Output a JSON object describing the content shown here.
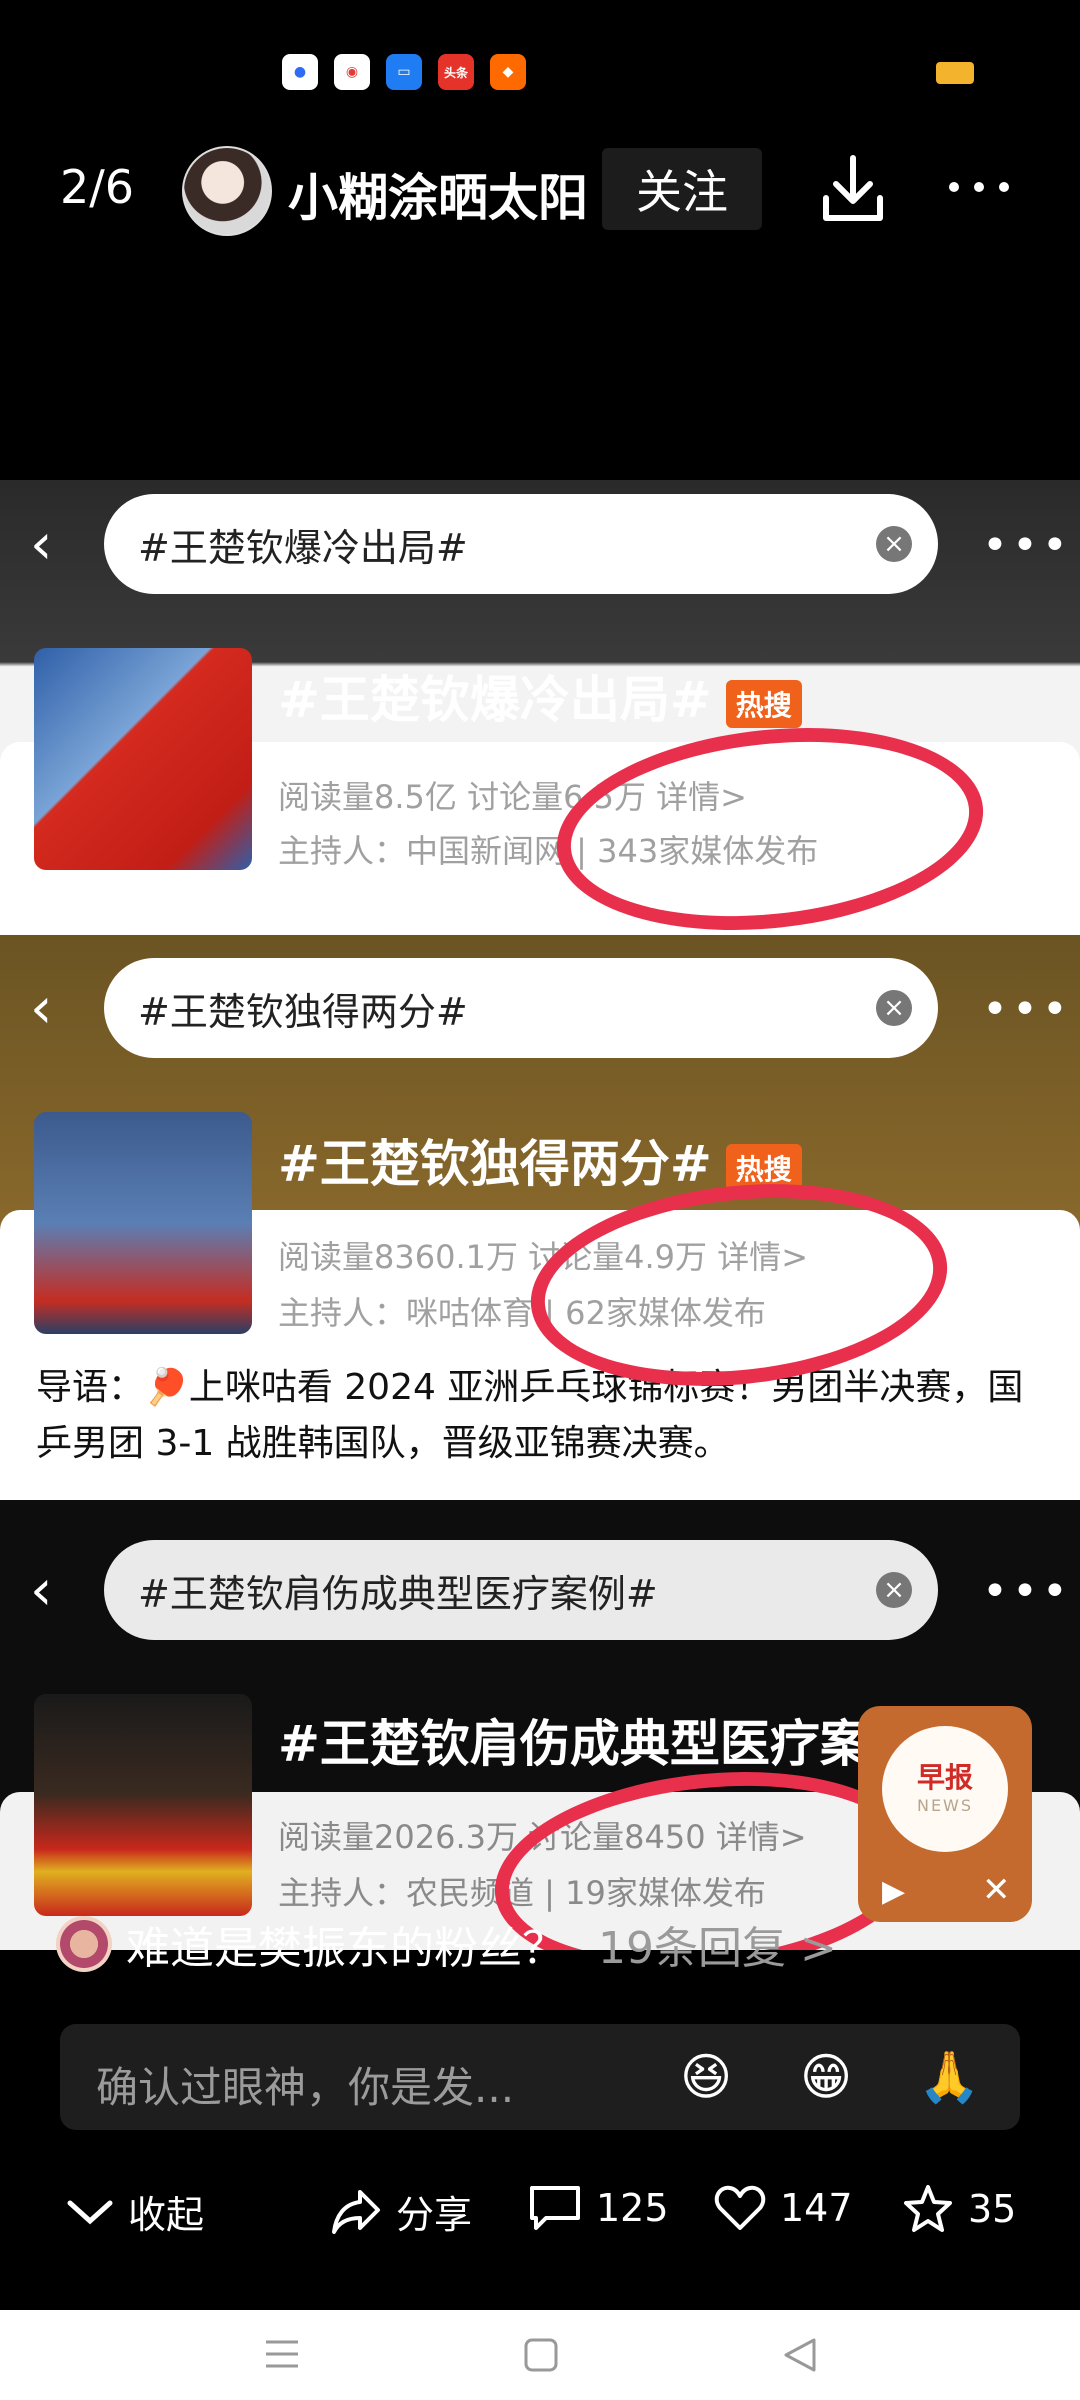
{
  "status_bar": {
    "apps": [
      {
        "icon": "baidu-icon",
        "label": "",
        "color": "#2f6cf5"
      },
      {
        "icon": "map-pin-app-icon",
        "label": "",
        "color": "#e23b3b"
      },
      {
        "icon": "folder-app-icon",
        "label": "",
        "color": "#1f7cf2"
      },
      {
        "icon": "toutiao-icon",
        "label": "头条",
        "color": "#e6332a"
      },
      {
        "icon": "shopping-app-icon",
        "label": "",
        "color": "#ff6a00"
      }
    ]
  },
  "header": {
    "counter": "2/6",
    "username": "小糊涂晒太阳",
    "follow_label": "关注"
  },
  "topics": [
    {
      "search_text": "#王楚钦爆冷出局#",
      "title": "#王楚钦爆冷出局#",
      "badge": "热搜",
      "meta1": "阅读量8.5亿   讨论量6.5万   详情>",
      "meta2": "主持人：中国新闻网 | 343家媒体发布"
    },
    {
      "search_text": "#王楚钦独得两分#",
      "title": "#王楚钦独得两分#",
      "badge": "热搜",
      "meta1": "阅读量8360.1万   讨论量4.9万   详情>",
      "meta2": "主持人：咪咕体育 | 62家媒体发布",
      "lead": "导语：🏓上咪咕看 2024 亚洲乒乓球锦标赛！男团半决赛，国乒男团 3-1 战胜韩国队，晋级亚锦赛决赛。"
    },
    {
      "search_text": "#王楚钦肩伤成典型医疗案例#",
      "title": "#王楚钦肩伤成典型医疗案例",
      "meta1": "阅读量2026.3万   讨论量8450   详情>",
      "meta2": "主持人：农民频道 | 19家媒体发布"
    }
  ],
  "news_card": {
    "title": "早报",
    "subtitle": "NEWS"
  },
  "reply": {
    "text": "难道是樊振东的粉丝？",
    "count": "19条回复 >"
  },
  "comment": {
    "placeholder": "确认过眼神，你是发...",
    "emojis": [
      "😆",
      "😁",
      "🙏"
    ]
  },
  "actions": {
    "collapse": "收起",
    "share": "分享",
    "comments": "125",
    "likes": "147",
    "favorites": "35"
  }
}
